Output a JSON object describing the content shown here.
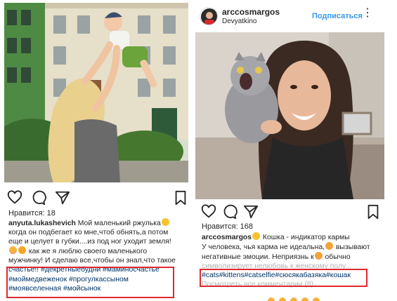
{
  "left_post": {
    "likes": "Нравится: 18",
    "caption": {
      "username": "anyuta.lukashevich",
      "lines": [
        " Мой маленький ржулька",
        "когда он подбегает ко мне,чтоб обнять,а потом",
        "еще и целует в губки....из под ног уходит земля!",
        " как же я люблю своего маленького",
        "мужчинку! И сделаю все,чтобы он знал,что такое",
        "счастье!! #декретныебудни #маминосчастье",
        "#моймедвеженок #прогулкассыном",
        "#моявселенная #мойсынок"
      ]
    }
  },
  "right_post": {
    "username": "arccosmargos",
    "location": "Devyatkino",
    "follow_label": "Подписаться",
    "likes": "Нравится: 168",
    "caption": {
      "username": "arccosmargos",
      "lines": [
        " Кошка - индикатор кармы",
        "У человека, чья карма не идеальна,",
        " вызывают",
        "негативные эмоции. Неприязнь к",
        " обычно",
        "символизирует нелюбовь к женскому полу...",
        "#cats#kittens#catselfie#сюсякабазяка#кошак",
        "Посмотреть все комментарии (8)"
      ]
    }
  },
  "icons": [
    "heart-icon",
    "comment-icon",
    "share-icon",
    "bookmark-icon",
    "more-icon"
  ],
  "colors": {
    "hashtag": "#003569",
    "follow": "#3897f0",
    "highlight": "#e0292f"
  }
}
